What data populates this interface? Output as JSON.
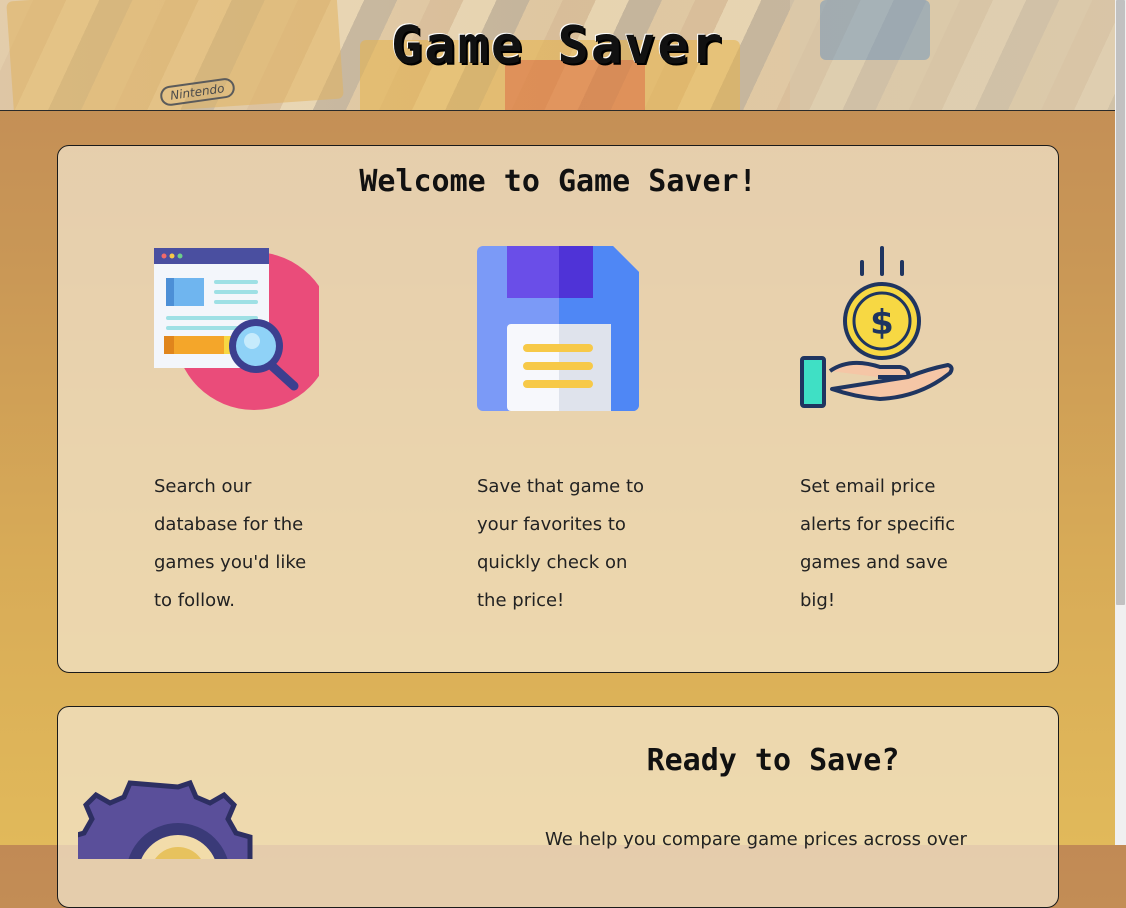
{
  "hero": {
    "title": "Game Saver",
    "label_text": "Nintendo"
  },
  "welcome": {
    "heading": "Welcome to Game Saver!",
    "features": [
      {
        "icon": "search-database-icon",
        "text": "Search our database for the games you'd like to follow."
      },
      {
        "icon": "floppy-save-icon",
        "text": "Save that game to your favorites to quickly check on the price!"
      },
      {
        "icon": "coin-hand-icon",
        "text": "Set email price alerts for specific games and save big!"
      }
    ]
  },
  "ready": {
    "heading": "Ready to Save?",
    "text": "We help you compare game prices across over"
  },
  "colors": {
    "accent_pink": "#ea4c7a",
    "floppy_blue": "#4f87f5",
    "coin_yellow": "#f7d843",
    "card_bg": "#ead7b6"
  }
}
